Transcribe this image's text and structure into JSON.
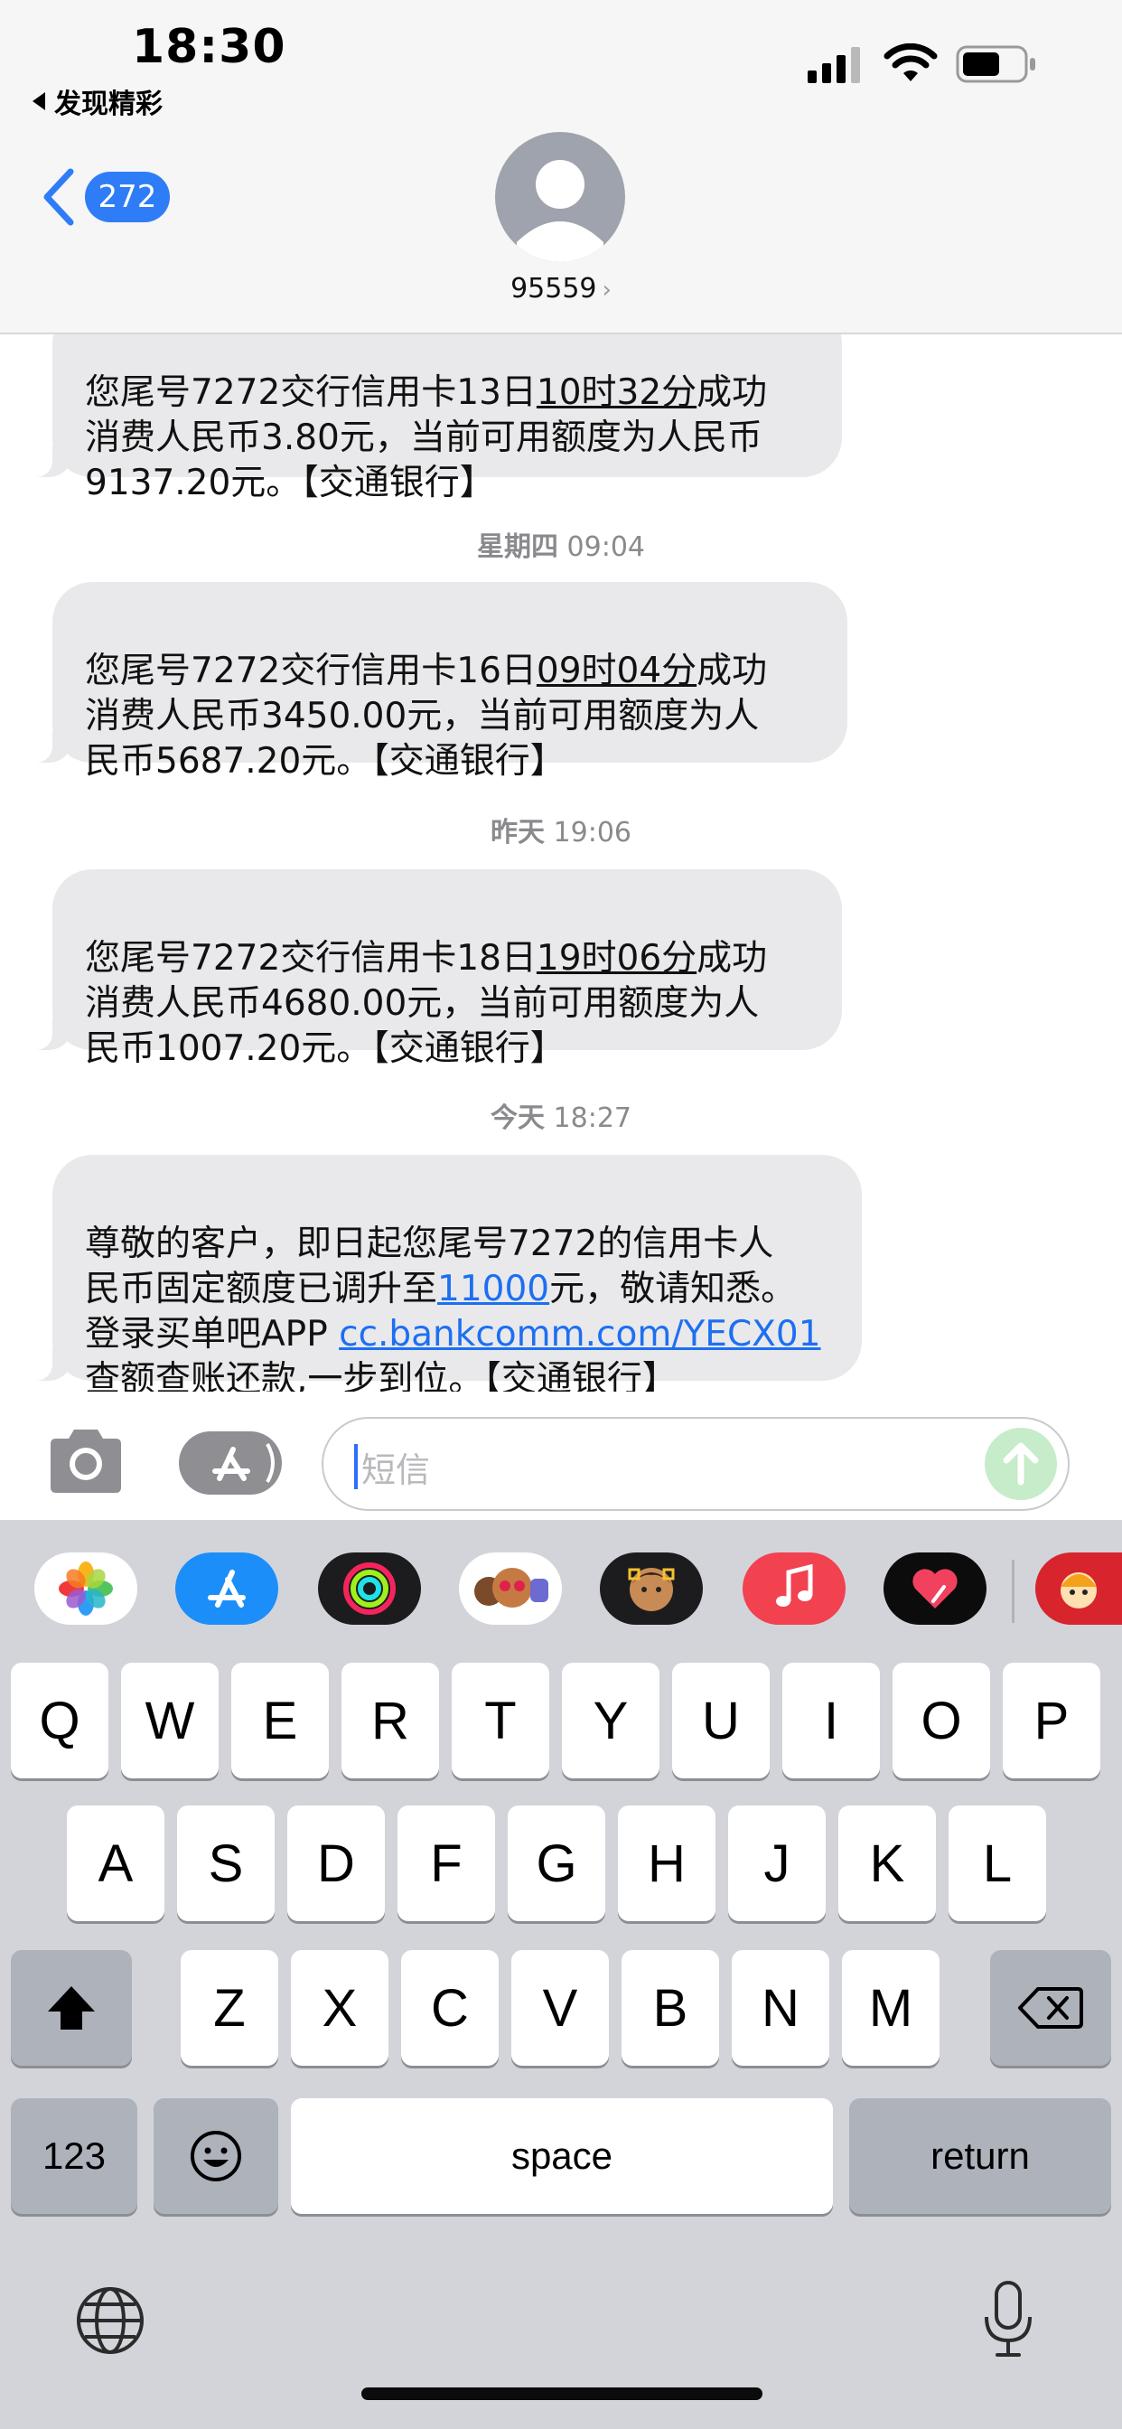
{
  "status_bar": {
    "time": "18:30",
    "back_app": "发现精彩"
  },
  "header": {
    "back_badge": "272",
    "contact": "95559",
    "contact_chevron": "›"
  },
  "messages": [
    {
      "line1_pre": "您尾号7272交行信用卡13日",
      "line1_ul": "10时32分",
      "line1_post": "成功",
      "rest": "消费人民币3.80元，当前可用额度为人民币\n9137.20元。【交通银行】"
    },
    {
      "timestamp_day": "星期四",
      "timestamp_time": " 09:04",
      "line1_pre": "您尾号7272交行信用卡16日",
      "line1_ul": "09时04分",
      "line1_post": "成功",
      "rest": "消费人民币3450.00元，当前可用额度为人\n民币5687.20元。【交通银行】"
    },
    {
      "timestamp_day": "昨天",
      "timestamp_time": " 19:06",
      "line1_pre": "您尾号7272交行信用卡18日",
      "line1_ul": "19时06分",
      "line1_post": "成功",
      "rest": "消费人民币4680.00元，当前可用额度为人\n民币1007.20元。【交通银行】"
    },
    {
      "timestamp_day": "今天",
      "timestamp_time": " 18:27",
      "line1": "尊敬的客户，即日起您尾号7272的信用卡人",
      "line2_pre": "民币固定额度已调升至",
      "line2_link": "11000",
      "line2_post": "元，敬请知悉。",
      "line3_pre": "登录买单吧APP ",
      "line3_link": "cc.bankcomm.com/YECX01",
      "line4": "查额查账还款,一步到位。【交通银行】"
    }
  ],
  "composer": {
    "placeholder": "短信"
  },
  "app_drawer": [
    {
      "name": "photos-icon",
      "bg": "#ffffff"
    },
    {
      "name": "app-store-icon",
      "bg": "#1c8ef9"
    },
    {
      "name": "activity-icon",
      "bg": "#1c1c1e"
    },
    {
      "name": "memoji-stickers-icon",
      "bg": "#ffffff"
    },
    {
      "name": "animoji-icon",
      "bg": "#1c1c1e"
    },
    {
      "name": "music-icon",
      "bg": "#f2414f"
    },
    {
      "name": "digital-touch-icon",
      "bg": "#0c0c0c"
    }
  ],
  "keyboard": {
    "row1": [
      "Q",
      "W",
      "E",
      "R",
      "T",
      "Y",
      "U",
      "I",
      "O",
      "P"
    ],
    "row2": [
      "A",
      "S",
      "D",
      "F",
      "G",
      "H",
      "J",
      "K",
      "L"
    ],
    "row3": [
      "Z",
      "X",
      "C",
      "V",
      "B",
      "N",
      "M"
    ],
    "numbers_label": "123",
    "space_label": "space",
    "return_label": "return"
  }
}
